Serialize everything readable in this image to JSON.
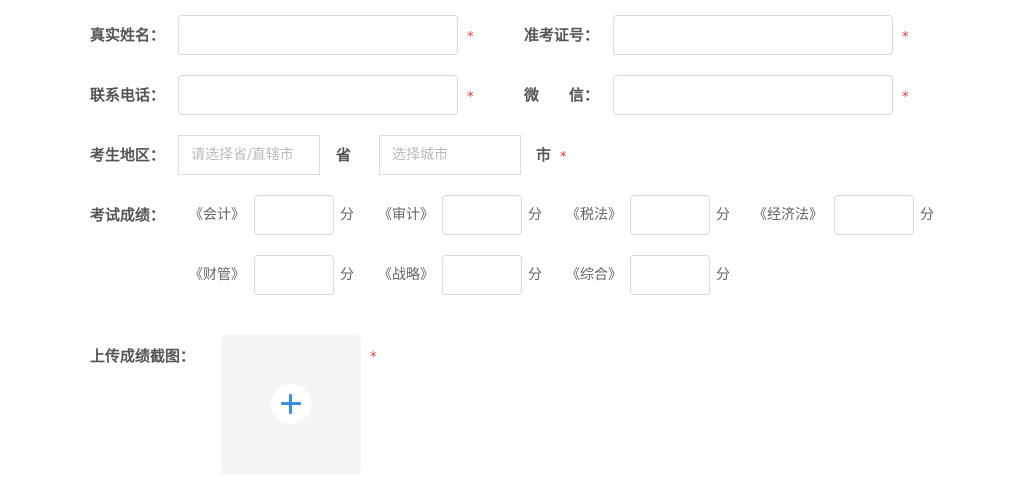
{
  "form": {
    "real_name": {
      "label": "真实姓名：",
      "value": "",
      "required": "*"
    },
    "ticket_no": {
      "label": "准考证号：",
      "value": "",
      "required": "*"
    },
    "phone": {
      "label": "联系电话：",
      "value": "",
      "required": "*"
    },
    "wechat": {
      "label": "微　　信：",
      "value": "",
      "required": "*"
    },
    "region": {
      "label": "考生地区：",
      "province_placeholder": "请选择省/直辖市",
      "province_unit": "省",
      "city_placeholder": "选择城市",
      "city_unit": "市",
      "required": "*"
    },
    "scores": {
      "label": "考试成绩：",
      "unit": "分",
      "subjects": [
        {
          "name": "《会计》",
          "value": ""
        },
        {
          "name": "《审计》",
          "value": ""
        },
        {
          "name": "《税法》",
          "value": ""
        },
        {
          "name": "《经济法》",
          "value": ""
        },
        {
          "name": "《财管》",
          "value": ""
        },
        {
          "name": "《战略》",
          "value": ""
        },
        {
          "name": "《综合》",
          "value": ""
        }
      ]
    },
    "upload": {
      "label": "上传成绩截图：",
      "required": "*",
      "icon": "plus-icon"
    }
  },
  "colors": {
    "required": "#e4393c",
    "accent": "#3a8ee6"
  }
}
